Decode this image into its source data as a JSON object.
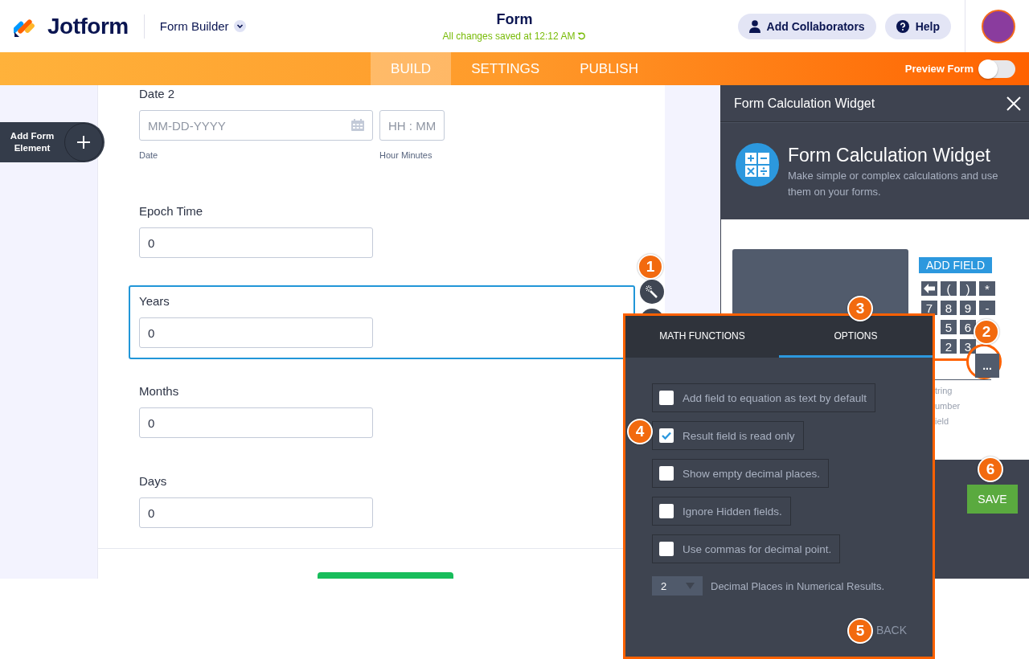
{
  "header": {
    "brand": "Jotform",
    "product": "Form Builder",
    "title": "Form",
    "save_status": "All changes saved at 12:12 AM",
    "buttons": [
      {
        "kind": "collaborators",
        "label": "Add Collaborators"
      },
      {
        "kind": "help",
        "label": "Help"
      }
    ]
  },
  "nav": {
    "tabs": [
      {
        "label": "BUILD",
        "selected": true
      },
      {
        "label": "SETTINGS",
        "selected": false
      },
      {
        "label": "PUBLISH",
        "selected": false
      }
    ],
    "preview": {
      "label": "Preview Form",
      "on": false
    }
  },
  "sidebar": {
    "add_button": "Add Form Element"
  },
  "form": {
    "fields": [
      {
        "kind": "datetime",
        "label": "Date 2",
        "date_placeholder": "MM-DD-YYYY",
        "time_placeholder": "HH : MM",
        "date_sublabel": "Date",
        "time_sublabel": "Hour Minutes",
        "selected": false
      },
      {
        "kind": "text",
        "label": "Epoch Time",
        "value": "0",
        "selected": false
      },
      {
        "kind": "text",
        "label": "Years",
        "value": "0",
        "selected": true
      },
      {
        "kind": "text",
        "label": "Months",
        "value": "0",
        "selected": false
      },
      {
        "kind": "text",
        "label": "Days",
        "value": "0",
        "selected": false
      }
    ]
  },
  "panel": {
    "header": "Form Calculation Widget",
    "title": "Form Calculation Widget",
    "description": "Make simple or complex calculations and use them on your forms.",
    "add_field": "ADD FIELD",
    "keypad": [
      [
        {
          "kind": "backspace"
        },
        {
          "kind": "key",
          "label": "("
        },
        {
          "kind": "key",
          "label": ")"
        },
        {
          "kind": "key",
          "label": "*"
        }
      ],
      [
        {
          "kind": "key",
          "label": "7"
        },
        {
          "kind": "key",
          "label": "8"
        },
        {
          "kind": "key",
          "label": "9"
        },
        {
          "kind": "key",
          "label": "-"
        }
      ],
      [
        {
          "kind": "key",
          "label": "5"
        },
        {
          "kind": "key",
          "label": "6"
        }
      ],
      [
        {
          "kind": "key",
          "label": "2"
        },
        {
          "kind": "key",
          "label": "3"
        }
      ],
      [
        {
          "kind": "more",
          "label": "..."
        }
      ]
    ],
    "notes": [
      "tring",
      "umber",
      "ield"
    ],
    "save": "SAVE"
  },
  "popup": {
    "tabs": [
      {
        "label": "MATH FUNCTIONS",
        "selected": false
      },
      {
        "label": "OPTIONS",
        "selected": true
      }
    ],
    "options": [
      {
        "label": "Add field to equation as text by default",
        "checked": false
      },
      {
        "label": "Result field is read only",
        "checked": true
      },
      {
        "label": "Show empty decimal places.",
        "checked": false
      },
      {
        "label": "Ignore Hidden fields.",
        "checked": false
      },
      {
        "label": "Use commas for decimal point.",
        "checked": false
      }
    ],
    "decimal": {
      "value": "2",
      "label": "Decimal Places in Numerical Results."
    },
    "back": "BACK"
  },
  "callouts": [
    "1",
    "2",
    "3",
    "4",
    "5",
    "6"
  ]
}
